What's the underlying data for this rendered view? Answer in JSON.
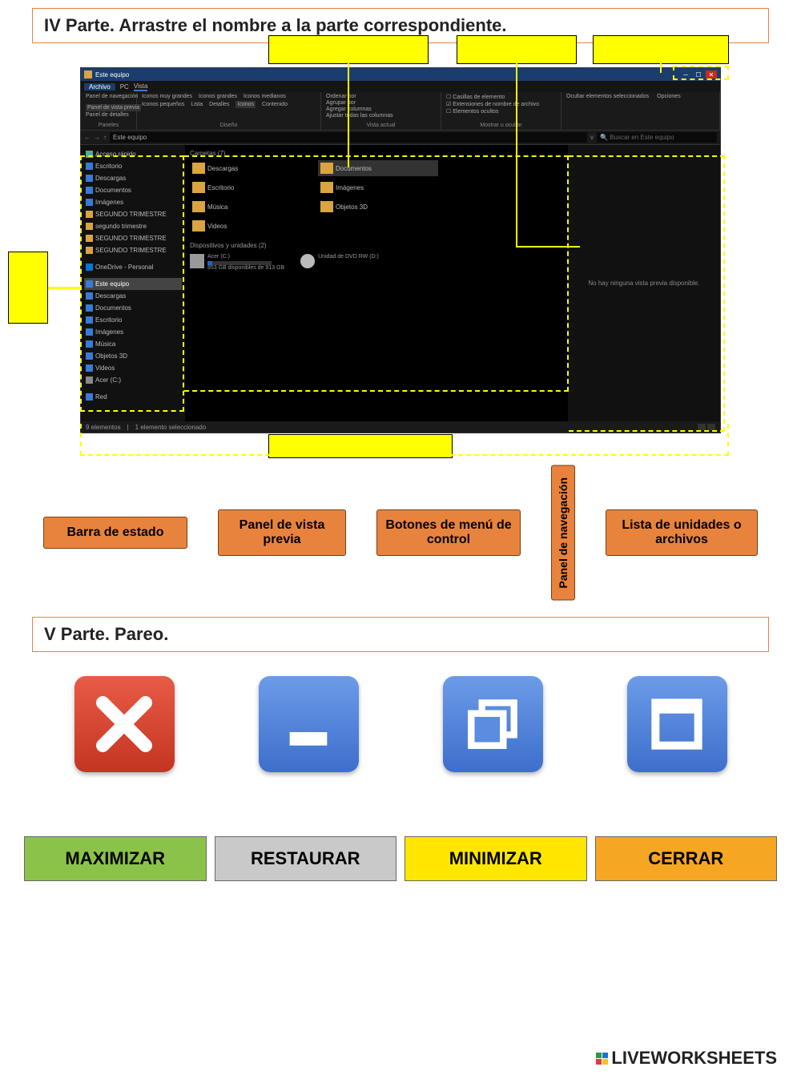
{
  "part4": {
    "title": "IV Parte. Arrastre el nombre a la parte correspondiente."
  },
  "explorer": {
    "window_title": "Este equipo",
    "menu": {
      "file": "Archivo",
      "pc": "PC",
      "vista": "Vista"
    },
    "ribbon_labels": {
      "paneles": "Paneles",
      "diseno": "Diseño",
      "vista_actual": "Vista actual",
      "mostrar": "Mostrar u ocultar"
    },
    "ribbon": {
      "panel_nav": "Panel de navegación",
      "vista_previa": "Panel de vista previa",
      "detalles": "Panel de detalles",
      "muy_grandes": "Iconos muy grandes",
      "grandes": "Iconos grandes",
      "medianos": "Iconos medianos",
      "pequenos": "Iconos pequeños",
      "lista": "Lista",
      "detalles2": "Detalles",
      "iconos": "Iconos",
      "contenido": "Contenido",
      "ordenar": "Ordenar por",
      "agrupar": "Agrupar por",
      "agregar": "Agregar columnas",
      "ajustar": "Ajustar todas las columnas",
      "casillas": "Casillas de elemento",
      "ext": "Extensiones de nombre de archivo",
      "ocultos": "Elementos ocultos",
      "ocultar_sel": "Ocultar elementos seleccionados",
      "opciones": "Opciones"
    },
    "breadcrumb": "Este equipo",
    "search_placeholder": "Buscar en Este equipo",
    "nav": [
      "Acceso rápido",
      "Escritorio",
      "Descargas",
      "Documentos",
      "Imágenes",
      "SEGUNDO TRIMESTRE",
      "segundo trimestre",
      "SEGUNDO TRIMESTRE",
      "SEGUNDO TRIMESTRE",
      "OneDrive - Personal",
      "Este equipo",
      "Descargas",
      "Documentos",
      "Escritorio",
      "Imágenes",
      "Música",
      "Objetos 3D",
      "Videos",
      "Acer (C:)",
      "Red"
    ],
    "folders_header": "Carpetas (7)",
    "folders": [
      "Descargas",
      "Documentos",
      "Escritorio",
      "Imágenes",
      "Música",
      "Objetos 3D",
      "Videos"
    ],
    "drives_header": "Dispositivos y unidades (2)",
    "drive_c": {
      "name": "Acer (C:)",
      "sub": "853 GB disponibles de 913 GB"
    },
    "drive_dvd": "Unidad de DVD RW (D:)",
    "preview_empty": "No hay ninguna vista previa disponible.",
    "status": {
      "items": "9 elementos",
      "sel": "1 elemento seleccionado"
    }
  },
  "orange_labels": {
    "estado": "Barra de estado",
    "vista": "Panel de vista previa",
    "botones": "Botones de menú de control",
    "nav": "Panel de navegación",
    "lista": "Lista de unidades o archivos"
  },
  "part5": {
    "title": "V Parte. Pareo."
  },
  "match": {
    "max": "MAXIMIZAR",
    "rest": "RESTAURAR",
    "min": "MINIMIZAR",
    "cer": "CERRAR"
  },
  "footer": "LIVEWORKSHEETS"
}
